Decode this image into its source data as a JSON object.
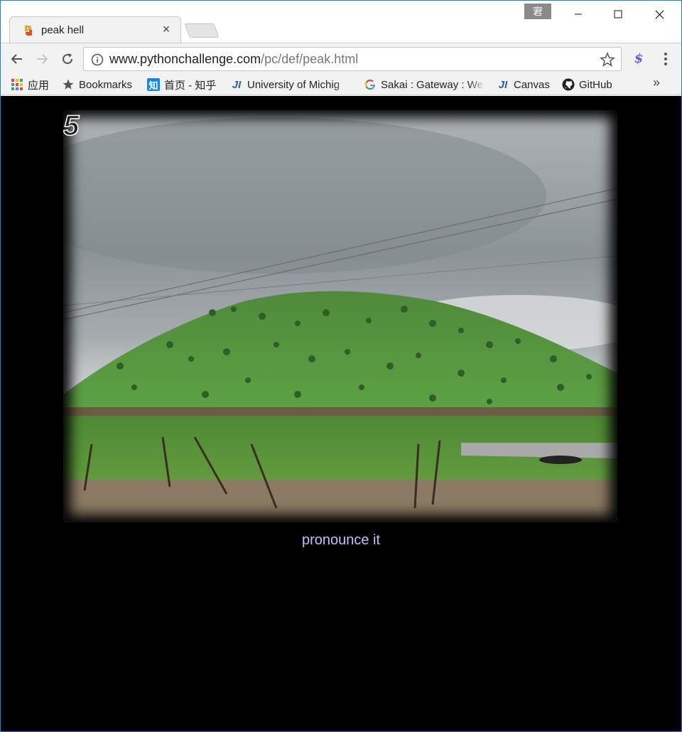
{
  "browser": {
    "tab": {
      "title": "peak hell",
      "close_symbol": "×",
      "favicon": "python-favicon"
    },
    "ime_indicator": "宭",
    "window_controls": [
      "minimize-icon",
      "maximize-icon",
      "close-icon"
    ],
    "address": {
      "host": "www.pythonchallenge.com",
      "path": "/pc/def/peak.html"
    },
    "extension": "$",
    "bookmarks": [
      {
        "label": "应用",
        "icon": "apps-grid-icon"
      },
      {
        "label": "Bookmarks",
        "icon": "star-icon"
      },
      {
        "label": "首页 - 知乎",
        "icon": "zhihu-icon",
        "icon_text": "知"
      },
      {
        "label": "University of Michig",
        "icon": "ji-icon",
        "icon_text": "JI"
      },
      {
        "label": "Sakai : Gateway : We",
        "icon": "google-icon"
      },
      {
        "label": "Canvas",
        "icon": "ji-icon",
        "icon_text": "JI"
      },
      {
        "label": "GitHub",
        "icon": "github-icon"
      }
    ],
    "bookmarks_overflow": "»"
  },
  "page": {
    "background": "#000000",
    "image": {
      "description_icon": "peak-hill-photo",
      "level_number": "5"
    },
    "link_text": "pronounce it",
    "link_color": "#c0c0ff"
  }
}
